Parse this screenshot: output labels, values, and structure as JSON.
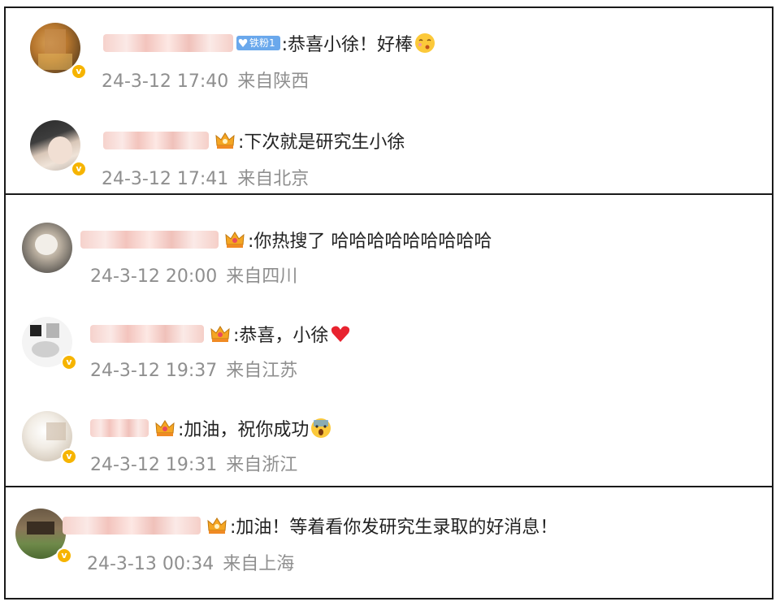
{
  "comments": [
    {
      "text": ":恭喜小徐！好棒",
      "fan_badge": "铁粉1",
      "time": "24-3-12 17:40",
      "location": "来自陕西",
      "emoji": "kissing-face"
    },
    {
      "text": ":下次就是研究生小徐",
      "time": "24-3-12 17:41",
      "location": "来自北京"
    },
    {
      "text": ":你热搜了 哈哈哈哈哈哈哈哈哈",
      "time": "24-3-12 20:00",
      "location": "来自四川"
    },
    {
      "text": ":恭喜，小徐",
      "time": "24-3-12 19:37",
      "location": "来自江苏",
      "emoji": "red-heart"
    },
    {
      "text": ":加油，祝你成功",
      "time": "24-3-12 19:31",
      "location": "来自浙江",
      "emoji": "screaming-face"
    },
    {
      "text": ":加油！等着看你发研究生录取的好消息！",
      "time": "24-3-13 00:34",
      "location": "来自上海"
    }
  ],
  "colors": {
    "meta_gray": "#8f8f8f",
    "verified_gold": "#f6b400",
    "fan_badge_blue": "#6aa8ec",
    "border": "#1a1a1a"
  }
}
